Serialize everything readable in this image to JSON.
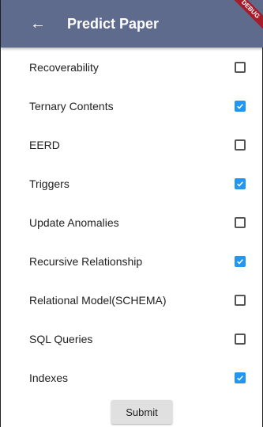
{
  "appbar": {
    "title": "Predict Paper",
    "back_icon": "arrow-left-icon",
    "banner_text": "DEBUG"
  },
  "topics": [
    {
      "label": "Recoverability",
      "checked": false
    },
    {
      "label": "Ternary Contents",
      "checked": true
    },
    {
      "label": "EERD",
      "checked": false
    },
    {
      "label": "Triggers",
      "checked": true
    },
    {
      "label": "Update Anomalies",
      "checked": false
    },
    {
      "label": "Recursive Relationship",
      "checked": true
    },
    {
      "label": "Relational Model(SCHEMA)",
      "checked": false
    },
    {
      "label": "SQL Queries",
      "checked": false
    },
    {
      "label": "Indexes",
      "checked": true
    }
  ],
  "submit_label": "Submit",
  "colors": {
    "appbar": "#5f6b8d",
    "checkbox_checked": "#2196f3",
    "banner": "#a51c2a"
  }
}
